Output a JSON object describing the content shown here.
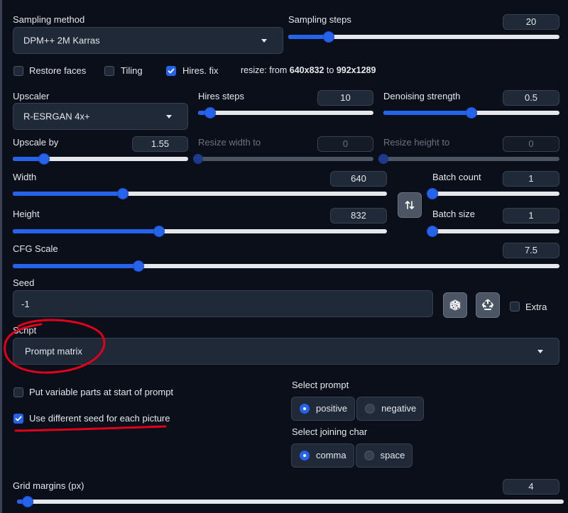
{
  "sampling": {
    "method_label": "Sampling method",
    "method_value": "DPM++ 2M Karras",
    "steps_label": "Sampling steps",
    "steps_value": "20",
    "steps_level": 0.15
  },
  "options": {
    "restore_faces_label": "Restore faces",
    "restore_faces_checked": false,
    "tiling_label": "Tiling",
    "tiling_checked": false,
    "hires_fix_label": "Hires. fix",
    "hires_fix_checked": true,
    "resize_prefix": "resize: from ",
    "resize_from": "640x832",
    "resize_to_word": " to ",
    "resize_to": "992x1289"
  },
  "hires": {
    "upscaler_label": "Upscaler",
    "upscaler_value": "R-ESRGAN 4x+",
    "steps_label": "Hires steps",
    "steps_value": "10",
    "steps_level": 0.07,
    "denoise_label": "Denoising strength",
    "denoise_value": "0.5",
    "denoise_level": 0.5,
    "upscale_by_label": "Upscale by",
    "upscale_by_value": "1.55",
    "upscale_by_level": 0.18,
    "resize_width_label": "Resize width to",
    "resize_width_value": "0",
    "resize_height_label": "Resize height to",
    "resize_height_value": "0"
  },
  "size": {
    "width_label": "Width",
    "width_value": "640",
    "width_level": 0.295,
    "height_label": "Height",
    "height_value": "832",
    "height_level": 0.39,
    "swap_icon": "swap-vertical-icon",
    "batch_count_label": "Batch count",
    "batch_count_value": "1",
    "batch_count_level": 0.0,
    "batch_size_label": "Batch size",
    "batch_size_value": "1",
    "batch_size_level": 0.0
  },
  "cfg": {
    "label": "CFG Scale",
    "value": "7.5",
    "level": 0.23
  },
  "seed": {
    "label": "Seed",
    "value": "-1",
    "dice_icon": "dice-icon",
    "recycle_icon": "recycle-icon",
    "extra_label": "Extra",
    "extra_checked": false
  },
  "script": {
    "label": "Script",
    "value": "Prompt matrix",
    "variable_parts_label": "Put variable parts at start of prompt",
    "variable_parts_checked": false,
    "different_seed_label": "Use different seed for each picture",
    "different_seed_checked": true,
    "select_prompt_label": "Select prompt",
    "prompt_options": [
      "positive",
      "negative"
    ],
    "prompt_selected": "positive",
    "joining_label": "Select joining char",
    "joining_options": [
      "comma",
      "space"
    ],
    "joining_selected": "comma"
  },
  "grid": {
    "label": "Grid margins (px)",
    "value": "4",
    "level": 0.02
  },
  "colors": {
    "background": "#0b0f19",
    "accent": "#2563eb",
    "annotation": "#e3001b"
  }
}
